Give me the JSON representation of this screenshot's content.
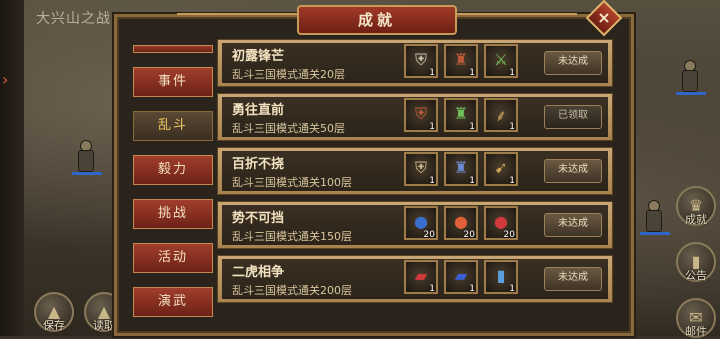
{
  "scene": {
    "title": "大兴山之战",
    "dim_text": "..."
  },
  "bottom_buttons": [
    {
      "label": "保存",
      "icon": "mountain-icon"
    },
    {
      "label": "读取",
      "icon": "mountain-icon"
    }
  ],
  "right_buttons": [
    {
      "label": "成就",
      "icon": "trophy-icon"
    },
    {
      "label": "公告",
      "icon": "scroll-icon"
    },
    {
      "label": "邮件",
      "icon": "mail-icon"
    }
  ],
  "modal": {
    "title": "成就",
    "close_label": "×"
  },
  "tabs": [
    {
      "label": "事件",
      "active": false
    },
    {
      "label": "乱斗",
      "active": true
    },
    {
      "label": "毅力",
      "active": false
    },
    {
      "label": "挑战",
      "active": false
    },
    {
      "label": "活动",
      "active": false
    },
    {
      "label": "演武",
      "active": false
    }
  ],
  "achievements": [
    {
      "name": "初露锋芒",
      "desc": "乱斗三国模式通关20层",
      "status": "未达成",
      "rewards": [
        {
          "icon": "armor-icon",
          "color": "#c9c3b2",
          "count": "1"
        },
        {
          "icon": "helmet-icon",
          "color": "#c05a3a",
          "count": "1"
        },
        {
          "icon": "sword-icon",
          "color": "#6fbf5a",
          "count": "1"
        }
      ]
    },
    {
      "name": "勇往直前",
      "desc": "乱斗三国模式通关50层",
      "status": "已领取",
      "rewards": [
        {
          "icon": "armor-icon",
          "color": "#c05a3a",
          "count": "1"
        },
        {
          "icon": "helmet-icon",
          "color": "#6fbf5a",
          "count": "1"
        },
        {
          "icon": "blade-icon",
          "color": "#c9a45a",
          "count": "1"
        }
      ]
    },
    {
      "name": "百折不挠",
      "desc": "乱斗三国模式通关100层",
      "status": "未达成",
      "rewards": [
        {
          "icon": "armor-icon",
          "color": "#c9b78a",
          "count": "1"
        },
        {
          "icon": "helmet-icon",
          "color": "#6b8ad0",
          "count": "1"
        },
        {
          "icon": "spear-icon",
          "color": "#c9a45a",
          "count": "1"
        }
      ]
    },
    {
      "name": "势不可挡",
      "desc": "乱斗三国模式通关150层",
      "status": "未达成",
      "rewards": [
        {
          "icon": "fruit-icon",
          "color": "#3a6fd0",
          "count": "20"
        },
        {
          "icon": "fruit-icon",
          "color": "#e0603a",
          "count": "20"
        },
        {
          "icon": "fruit-icon",
          "color": "#d03a3a",
          "count": "20"
        }
      ]
    },
    {
      "name": "二虎相争",
      "desc": "乱斗三国模式通关200层",
      "status": "未达成",
      "rewards": [
        {
          "icon": "book-icon",
          "color": "#d03a3a",
          "count": "1"
        },
        {
          "icon": "book-icon",
          "color": "#3a5fd0",
          "count": "1"
        },
        {
          "icon": "scroll-icon",
          "color": "#5aa0e0",
          "count": "1"
        }
      ]
    }
  ]
}
